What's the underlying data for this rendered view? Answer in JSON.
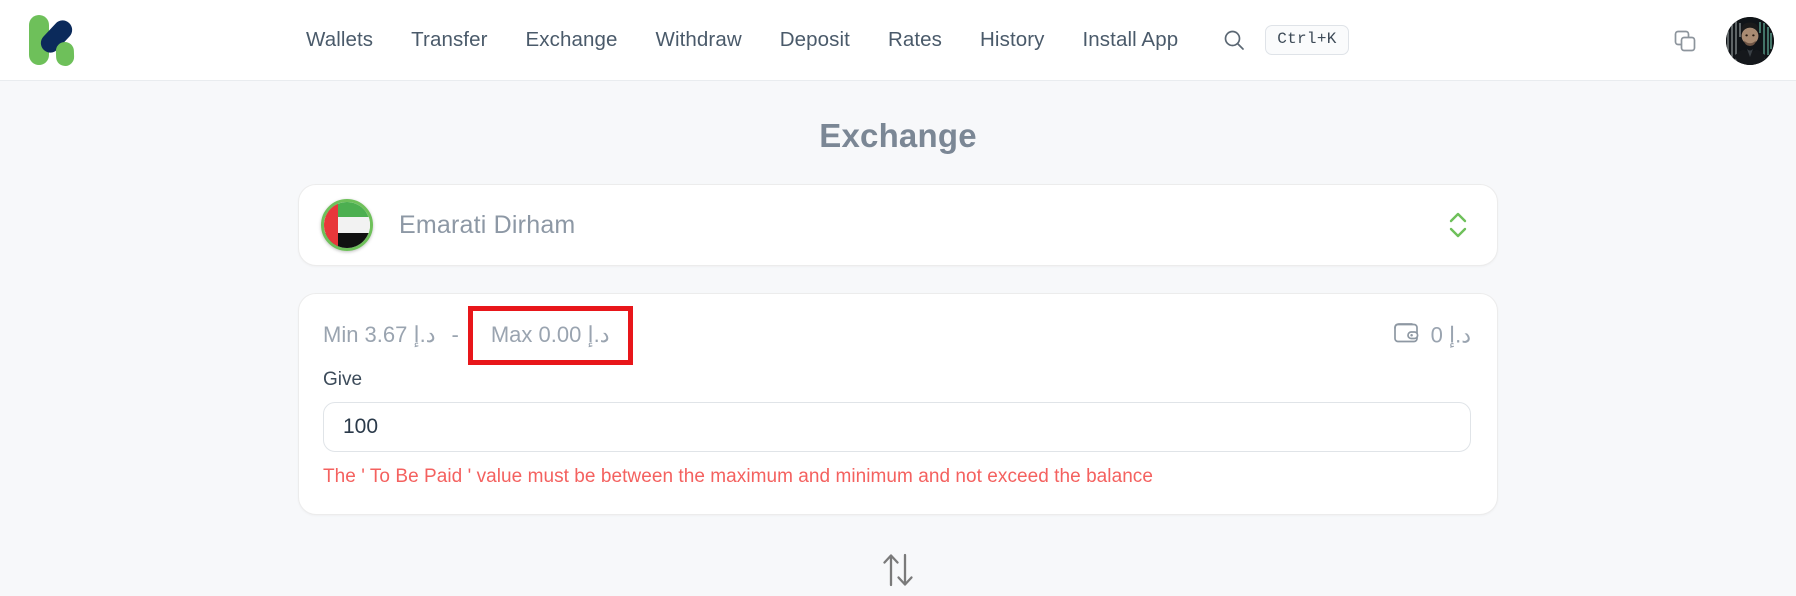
{
  "header": {
    "logo": {
      "name": "kazang-logo",
      "green": "#6ec05a",
      "navy": "#0b2a5b"
    },
    "nav": [
      {
        "label": "Wallets",
        "name": "nav-wallets"
      },
      {
        "label": "Transfer",
        "name": "nav-transfer"
      },
      {
        "label": "Exchange",
        "name": "nav-exchange"
      },
      {
        "label": "Withdraw",
        "name": "nav-withdraw"
      },
      {
        "label": "Deposit",
        "name": "nav-deposit"
      },
      {
        "label": "Rates",
        "name": "nav-rates"
      },
      {
        "label": "History",
        "name": "nav-history"
      },
      {
        "label": "Install App",
        "name": "nav-install-app"
      }
    ],
    "search": {
      "icon": "search-icon",
      "shortcut": "Ctrl+K"
    },
    "copy_icon": "copy-icon",
    "avatar": "user-avatar"
  },
  "page": {
    "title": "Exchange"
  },
  "currency_selector": {
    "flag": "uae-flag-icon",
    "name": "Emarati Dirham",
    "chevron": "chevron-up-down-icon",
    "accent": "#6ec05a"
  },
  "amount_section": {
    "min_label": "Min 3.67 د.إ",
    "dash": "-",
    "max_label": "Max 0.00 د.إ",
    "max_highlight_color": "#e8161a",
    "wallet_icon": "wallet-icon",
    "balance": "0 د.إ",
    "give_label": "Give",
    "input_value": "100",
    "input_placeholder": "",
    "error": "The ' To Be Paid ' value must be between the maximum and minimum and not exceed the balance",
    "error_color": "#f4615f"
  },
  "swap": {
    "icon": "swap-vertical-arrows-icon"
  }
}
